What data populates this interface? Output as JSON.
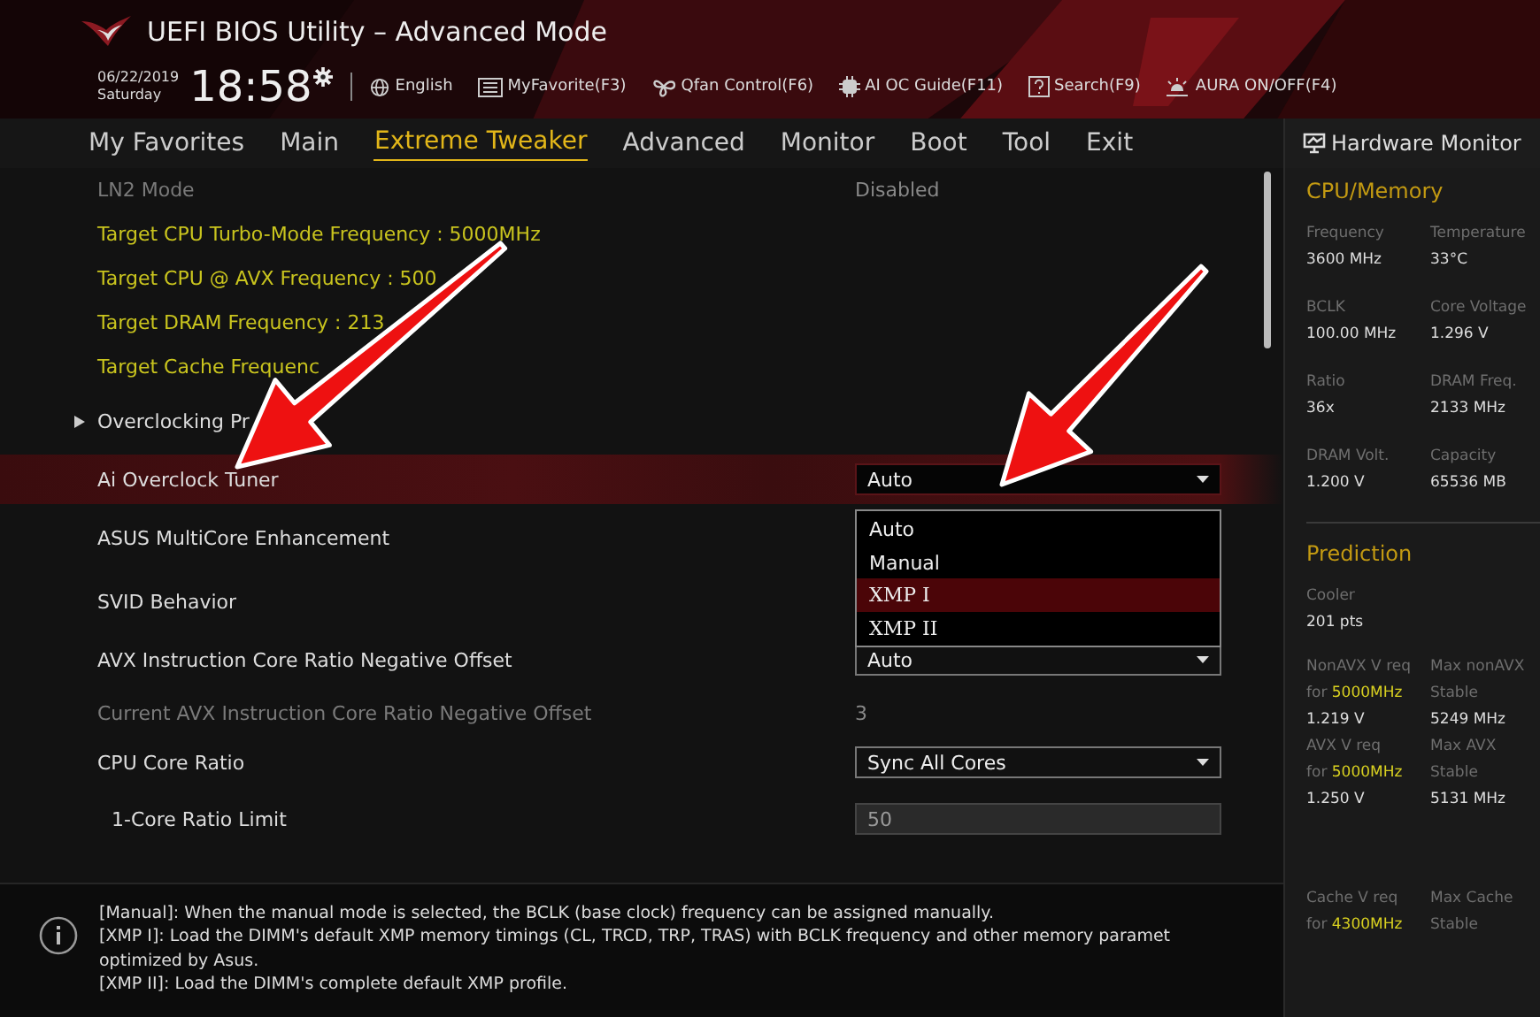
{
  "header": {
    "title": "UEFI BIOS Utility – Advanced Mode",
    "date": "06/22/2019",
    "day": "Saturday",
    "time": "18:58",
    "toolbar": [
      {
        "kind": "globe",
        "label": "English"
      },
      {
        "kind": "favorite",
        "label": "MyFavorite(F3)"
      },
      {
        "kind": "fan",
        "label": "Qfan Control(F6)"
      },
      {
        "kind": "chip",
        "label": "AI OC Guide(F11)"
      },
      {
        "kind": "help",
        "label": "Search(F9)"
      },
      {
        "kind": "light",
        "label": "AURA ON/OFF(F4)"
      }
    ]
  },
  "tabs": [
    {
      "label": "My Favorites",
      "selected": false
    },
    {
      "label": "Main",
      "selected": false
    },
    {
      "label": "Extreme Tweaker",
      "selected": true
    },
    {
      "label": "Advanced",
      "selected": false
    },
    {
      "label": "Monitor",
      "selected": false
    },
    {
      "label": "Boot",
      "selected": false
    },
    {
      "label": "Tool",
      "selected": false
    },
    {
      "label": "Exit",
      "selected": false
    }
  ],
  "settings": [
    {
      "kind": "disabled",
      "label": "LN2 Mode",
      "selected": false,
      "value": {
        "kind": "text",
        "text": "Disabled"
      }
    },
    {
      "kind": "info",
      "label": "Target CPU Turbo-Mode Frequency : 5000MHz",
      "selected": false
    },
    {
      "kind": "info",
      "label": "Target CPU @ AVX Frequency : 500",
      "selected": false
    },
    {
      "kind": "info",
      "label": "Target DRAM Frequency : 213",
      "selected": false
    },
    {
      "kind": "info",
      "label": "Target Cache Frequenc",
      "selected": false
    },
    {
      "kind": "submenu",
      "label": "Overclocking Pr",
      "selected": false
    },
    {
      "kind": "setting",
      "label": "Ai Overclock Tuner",
      "selected": true,
      "value": {
        "kind": "select",
        "text": "Auto"
      }
    },
    {
      "kind": "setting",
      "label": "ASUS MultiCore Enhancement",
      "selected": false
    },
    {
      "kind": "setting",
      "label": "SVID Behavior",
      "selected": false
    },
    {
      "kind": "setting",
      "label": "AVX Instruction Core Ratio Negative Offset",
      "selected": false,
      "value": {
        "kind": "select",
        "text": "Auto"
      }
    },
    {
      "kind": "disabled",
      "label": "Current AVX Instruction Core Ratio Negative Offset",
      "selected": false,
      "value": {
        "kind": "text",
        "text": "3"
      }
    },
    {
      "kind": "setting",
      "label": "CPU Core Ratio",
      "selected": false,
      "value": {
        "kind": "select",
        "text": "Sync All Cores"
      }
    },
    {
      "kind": "subsetting",
      "label": "1-Core Ratio Limit",
      "selected": false,
      "value": {
        "kind": "input",
        "text": "50"
      }
    }
  ],
  "dropdown": {
    "options": [
      {
        "label": "Auto",
        "selected": false
      },
      {
        "label": "Manual",
        "selected": false
      },
      {
        "label": "XMP I",
        "selected": true
      },
      {
        "label": "XMP II",
        "selected": false
      }
    ]
  },
  "help": {
    "lines": [
      "[Manual]: When the manual mode is selected, the BCLK (base clock) frequency can be assigned manually.",
      "[XMP I]:  Load the DIMM's default XMP memory timings (CL, TRCD, TRP, TRAS) with BCLK frequency and other memory paramet",
      "optimized by Asus.",
      "[XMP II]:  Load the DIMM's complete default XMP profile."
    ]
  },
  "hardware_monitor": {
    "title": "Hardware Monitor",
    "sections": [
      {
        "title": "CPU/Memory",
        "items": [
          {
            "label": "Frequency",
            "value": "3600 MHz"
          },
          {
            "label": "Temperature",
            "value": "33°C"
          },
          {
            "label": "BCLK",
            "value": "100.00 MHz"
          },
          {
            "label": "Core Voltage",
            "value": "1.296 V"
          },
          {
            "label": "Ratio",
            "value": "36x"
          },
          {
            "label": "DRAM Freq.",
            "value": "2133 MHz"
          },
          {
            "label": "DRAM Volt.",
            "value": "1.200 V"
          },
          {
            "label": "Capacity",
            "value": "65536 MB"
          }
        ]
      },
      {
        "title": "Prediction",
        "items": [
          {
            "label": "Cooler",
            "value": "201 pts"
          },
          {
            "label": "NonAVX V req",
            "sub": "for",
            "freq": "5000MHz",
            "value": "1.219 V"
          },
          {
            "label": "Max nonAVX",
            "sub": "Stable",
            "value": "5249 MHz"
          },
          {
            "label": "AVX V req",
            "sub": "for",
            "freq": "5000MHz",
            "value": "1.250 V"
          },
          {
            "label": "Max AVX",
            "sub": "Stable",
            "value": "5131 MHz"
          },
          {
            "label": "Cache V req",
            "sub": "for",
            "freq": "4300MHz"
          },
          {
            "label": "Max Cache",
            "sub": "Stable"
          }
        ]
      }
    ]
  }
}
